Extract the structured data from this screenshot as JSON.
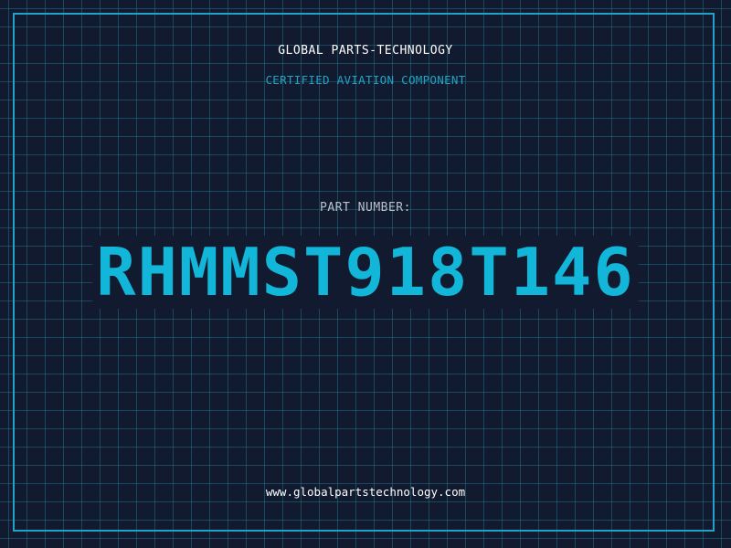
{
  "header": {
    "company": "GLOBAL PARTS-TECHNOLOGY",
    "subtitle": "CERTIFIED AVIATION COMPONENT"
  },
  "part": {
    "label": "PART NUMBER:",
    "number": "RHMMST918T146"
  },
  "footer": {
    "website": "www.globalpartstechnology.com"
  },
  "colors": {
    "background": "#111a2e",
    "grid": "#216e82",
    "accent": "#12b6d8",
    "frame": "#1fa3c7",
    "text": "#ffffff",
    "label": "#b7c0cc"
  }
}
